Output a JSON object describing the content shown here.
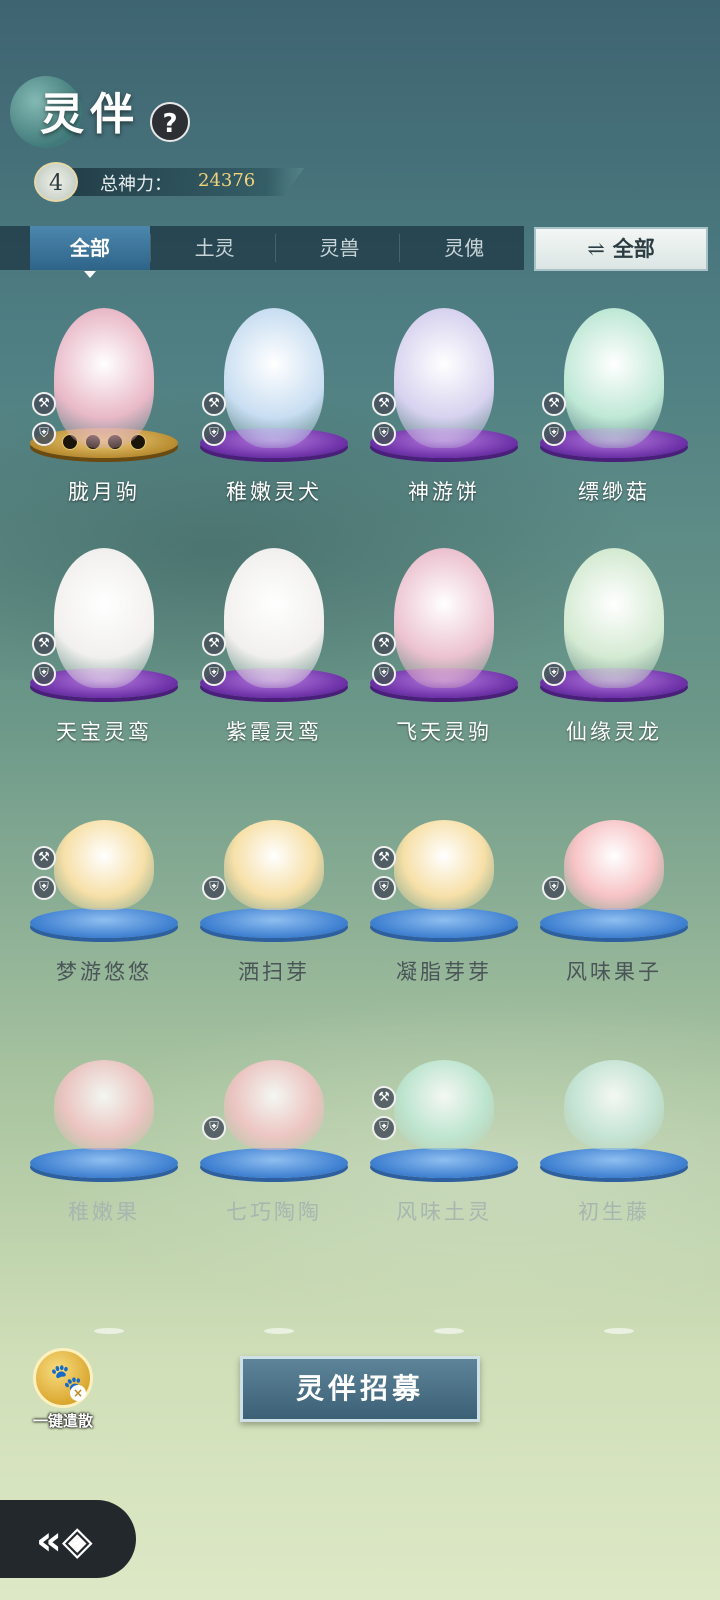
{
  "header": {
    "title": "灵伴",
    "help_icon": "?",
    "level": "4",
    "power_label": "总神力：",
    "power_value": "24376"
  },
  "tabs": [
    {
      "label": "全部",
      "active": true
    },
    {
      "label": "土灵",
      "active": false
    },
    {
      "label": "灵兽",
      "active": false
    },
    {
      "label": "灵傀",
      "active": false
    }
  ],
  "filter": {
    "icon": "swap-arrows-icon",
    "arrow": "⇌",
    "label": "全部"
  },
  "companions": [
    {
      "name": "胧月驹",
      "pedestal": "gold",
      "color": "#e9b9c8",
      "owned": true
    },
    {
      "name": "稚嫩灵犬",
      "pedestal": "purple",
      "color": "#c9def2",
      "owned": true
    },
    {
      "name": "神游饼",
      "pedestal": "purple",
      "color": "#d7d2ef",
      "owned": true
    },
    {
      "name": "缥缈菇",
      "pedestal": "purple",
      "color": "#bfe8d6",
      "owned": true
    },
    {
      "name": "天宝灵鸾",
      "pedestal": "purple",
      "color": "#f1f0ee",
      "owned": true
    },
    {
      "name": "紫霞灵鸾",
      "pedestal": "purple",
      "color": "#f1f0ee",
      "owned": true
    },
    {
      "name": "飞天灵驹",
      "pedestal": "purple",
      "color": "#ecc2d0",
      "owned": true
    },
    {
      "name": "仙缘灵龙",
      "pedestal": "purple",
      "color": "#d4ead2",
      "owned": true
    },
    {
      "name": "梦游悠悠",
      "pedestal": "blue",
      "color": "#f7e0a8",
      "owned": true
    },
    {
      "name": "洒扫芽",
      "pedestal": "blue",
      "color": "#f7e0a8",
      "owned": true
    },
    {
      "name": "凝脂芽芽",
      "pedestal": "blue",
      "color": "#f7e0a8",
      "owned": true
    },
    {
      "name": "风味果子",
      "pedestal": "blue",
      "color": "#f7c3c5",
      "owned": true
    },
    {
      "name": "稚嫩果",
      "pedestal": "blue",
      "color": "#f6c4c6",
      "owned": false
    },
    {
      "name": "七巧陶陶",
      "pedestal": "blue",
      "color": "#f6c4c6",
      "owned": false
    },
    {
      "name": "风味土灵",
      "pedestal": "blue",
      "color": "#bfe9d6",
      "owned": false
    },
    {
      "name": "初生藤",
      "pedestal": "blue",
      "color": "#c7e8dc",
      "owned": false
    }
  ],
  "badges": {
    "tool": "⚒",
    "shield": "⛨"
  },
  "bottom": {
    "dismiss_label": "一键遣散",
    "dismiss_icon": "paw-icon",
    "paw": "🐾",
    "x": "×",
    "recruit_label": "灵伴招募",
    "back_icon": "back-arrow-icon",
    "back_glyph": "«◈"
  }
}
